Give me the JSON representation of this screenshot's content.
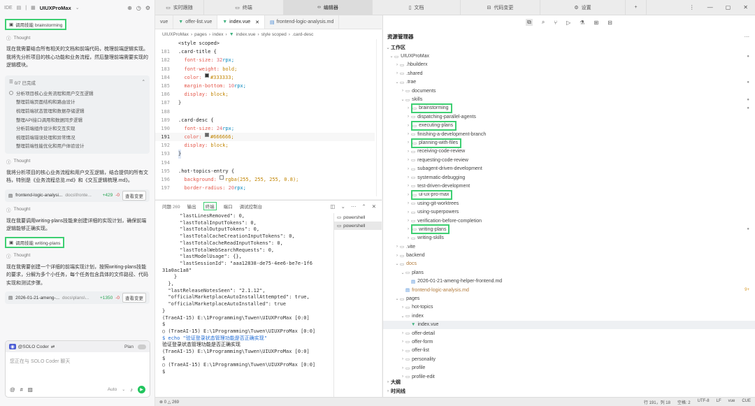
{
  "left": {
    "topbar": {
      "tab_label": "IDE",
      "project": "UIUXProMax"
    },
    "tool_call_1": "调用技能 brainstorming",
    "thought_label": "Thought",
    "para_1": "现在我需要结合所有相关的文档和前端代码，梳理前端逻辑实现。我将先分析项目的核心功能和业务流程，然后整理前端需要实现的逻辑模块。",
    "todo": {
      "header": "0/7 已完成",
      "items": [
        "分析项目核心业务流程和用户交互逻辑",
        "整理前端页面结构和路由设计",
        "梳理前端状态管理和数据存储逻辑",
        "整理API接口调用和数据同步逻辑",
        "分析前端组件设计和交互实现",
        "梳理前端错误处理和异常情况",
        "整理前端性能优化和用户体验设计"
      ]
    },
    "para_2": "我将分析项目的核心业务流程和用户交互逻辑，结合提供的所有文档，特别是《业务流程总览.md》和《交互逻辑梳理.md》。",
    "file_1": {
      "name": "frontend-logic-analysi...",
      "path": "docs\\fronte...",
      "add": "+429",
      "del": "-0",
      "button": "查看变更"
    },
    "para_3": "现在我要调用writing-plans技能来创建详细的实现计划，确保前端逻辑能够正确实现。",
    "tool_call_2": "调用技能 writing-plans",
    "para_4": "现在我需要创建一个详细的前端实现计划，按照writing-plans技能的要求，分解为多个小任务，每个任务包含具体的文件路径、代码实现和测试步骤。",
    "file_2": {
      "name": "2026-01-21-ameng-...",
      "path": "docs\\plans\\...",
      "add": "+1350",
      "del": "-0",
      "button": "查看变更"
    },
    "chat": {
      "title": "@SOLO Coder",
      "plan": "Plan",
      "placeholder": "您正在与 SOLO Coder 聊天",
      "auto": "Auto"
    }
  },
  "topbar": {
    "tabs": [
      "实时跟随",
      "终端",
      "编辑器",
      "文档",
      "代码变更",
      "设置"
    ]
  },
  "editor": {
    "tabs": [
      "vue",
      "offer-list.vue",
      "index.vue",
      "frontend-logic-analysis.md"
    ],
    "breadcrumb": [
      "UIUXProMax",
      "pages",
      "index",
      "index.vue",
      "style scoped",
      ".card-desc"
    ],
    "style_header": "<style scoped>",
    "line_numbers": [
      "181",
      "182",
      "183",
      "184",
      "185",
      "186",
      "187",
      "188",
      "189",
      "190",
      "191",
      "192",
      "193",
      "194",
      "195",
      "196",
      "197"
    ],
    "code": {
      "l181": ".card-title {",
      "l182_p": "font-size:",
      "l182_v": "32",
      "l182_u": "rpx;",
      "l183_p": "font-weight:",
      "l183_v": "bold;",
      "l184_p": "color:",
      "l184_v": "#333333;",
      "l185_p": "margin-bottom:",
      "l185_v": "10",
      "l185_u": "rpx;",
      "l186_p": "display:",
      "l186_v": "block;",
      "l187": "}",
      "l189": ".card-desc {",
      "l190_p": "font-size:",
      "l190_v": "24",
      "l190_u": "rpx;",
      "l191_p": "color:",
      "l191_v": "#666666;",
      "l192_p": "display:",
      "l192_v": "block;",
      "l193": "}",
      "l195": ".hot-topics-entry {",
      "l196_p": "background:",
      "l196_v": "rgba(255, 255, 255, 0.8);",
      "l197_p": "border-radius:",
      "l197_v": "20",
      "l197_u": "rpx;"
    }
  },
  "terminal": {
    "tabs": [
      "问题",
      "269",
      "输出",
      "终端",
      "端口",
      "调试控制台"
    ],
    "lines": [
      "      \"lastLinesRemoved\": 0,",
      "      \"lastTotalInputTokens\": 0,",
      "      \"lastTotalOutputTokens\": 0,",
      "      \"lastTotalCacheCreationInputTokens\": 0,",
      "      \"lastTotalCacheReadInputTokens\": 0,",
      "      \"lastTotalWebSearchRequests\": 0,",
      "      \"lastModelUsage\": {},",
      "      \"lastSessionId\": \"aaa12838-de75-4ee6-be7e-1f6",
      "31a0ac1a8\"",
      "    }",
      "  },",
      "  \"lastReleaseNotesSeen\": \"2.1.12\",",
      "  \"officialMarketplaceAutoInstallAttempted\": true,",
      "  \"officialMarketplaceAutoInstalled\": true",
      "}",
      "(TraeAI-15) E:\\1Programming\\Tuwen\\UIUXProMax [0:0]",
      "$",
      "○ (TraeAI-15) E:\\1Programming\\Tuwen\\UIUXProMax [0:0]",
      "$ echo \"验证登录状态管理功能是否正确实现\"",
      "验证登录状态管理功能是否正确实现",
      "(TraeAI-15) E:\\1Programming\\Tuwen\\UIUXProMax [0:0]",
      "$",
      "○ (TraeAI-15) E:\\1Programming\\Tuwen\\UIUXProMax [0:0]",
      "$"
    ],
    "shells": [
      "powershell",
      "powershell"
    ]
  },
  "explorer": {
    "title": "资源管理器",
    "workspace": "工作区",
    "rows": [
      {
        "d": 0,
        "t": "folder",
        "name": "UIUXProMax",
        "open": true,
        "dot": true
      },
      {
        "d": 1,
        "t": "folder",
        "name": ".hbuilderx"
      },
      {
        "d": 1,
        "t": "folder",
        "name": ".shared"
      },
      {
        "d": 1,
        "t": "folder",
        "name": ".trae",
        "open": true,
        "dot": true
      },
      {
        "d": 2,
        "t": "folder",
        "name": "documents"
      },
      {
        "d": 2,
        "t": "folder",
        "name": "skills",
        "open": true,
        "dot": true
      },
      {
        "d": 3,
        "t": "folder",
        "name": "brainstorming",
        "hl": true,
        "dot": true
      },
      {
        "d": 3,
        "t": "folder",
        "name": "dispatching-parallel-agents"
      },
      {
        "d": 3,
        "t": "folder",
        "name": "executing-plans",
        "hl": true
      },
      {
        "d": 3,
        "t": "folder",
        "name": "finishing-a-development-branch"
      },
      {
        "d": 3,
        "t": "folder",
        "name": "planning-with-files",
        "hl": true
      },
      {
        "d": 3,
        "t": "folder",
        "name": "receiving-code-review"
      },
      {
        "d": 3,
        "t": "folder",
        "name": "requesting-code-review"
      },
      {
        "d": 3,
        "t": "folder",
        "name": "subagent-driven-development"
      },
      {
        "d": 3,
        "t": "folder",
        "name": "systematic-debugging"
      },
      {
        "d": 3,
        "t": "folder",
        "name": "test-driven-development"
      },
      {
        "d": 3,
        "t": "folder",
        "name": "ui-ux-pro-max",
        "hl": true
      },
      {
        "d": 3,
        "t": "folder",
        "name": "using-git-worktrees"
      },
      {
        "d": 3,
        "t": "folder",
        "name": "using-superpowers"
      },
      {
        "d": 3,
        "t": "folder",
        "name": "verification-before-completion"
      },
      {
        "d": 3,
        "t": "folder",
        "name": "writing-plans",
        "hl": true,
        "dot": true
      },
      {
        "d": 3,
        "t": "folder",
        "name": "writing-skills"
      },
      {
        "d": 1,
        "t": "folder",
        "name": ".vite"
      },
      {
        "d": 1,
        "t": "folder",
        "name": "backend"
      },
      {
        "d": 1,
        "t": "folder",
        "name": "docs",
        "open": true,
        "dim": true
      },
      {
        "d": 2,
        "t": "folder",
        "name": "plans",
        "open": true
      },
      {
        "d": 3,
        "t": "file",
        "name": "2026-01-21-ameng-helper-frontend.md"
      },
      {
        "d": 2,
        "t": "file",
        "name": "frontend-logic-analysis.md",
        "dim": true,
        "badge": "9+"
      },
      {
        "d": 1,
        "t": "folder",
        "name": "pages",
        "open": true
      },
      {
        "d": 2,
        "t": "folder",
        "name": "hot-topics"
      },
      {
        "d": 2,
        "t": "folder",
        "name": "index",
        "open": true
      },
      {
        "d": 3,
        "t": "vue",
        "name": "index.vue",
        "sel": true
      },
      {
        "d": 2,
        "t": "folder",
        "name": "offer-detail"
      },
      {
        "d": 2,
        "t": "folder",
        "name": "offer-form"
      },
      {
        "d": 2,
        "t": "folder",
        "name": "offer-list"
      },
      {
        "d": 2,
        "t": "folder",
        "name": "personality"
      },
      {
        "d": 2,
        "t": "folder",
        "name": "profile"
      },
      {
        "d": 2,
        "t": "folder",
        "name": "profile-edit"
      }
    ],
    "outline": "大纲",
    "timeline": "时间线"
  },
  "status": {
    "left": "⊗ 0 △ 269",
    "right": [
      "行 191，列 18",
      "空格: 2",
      "UTF-8",
      "LF",
      "vue",
      "CUE"
    ]
  }
}
